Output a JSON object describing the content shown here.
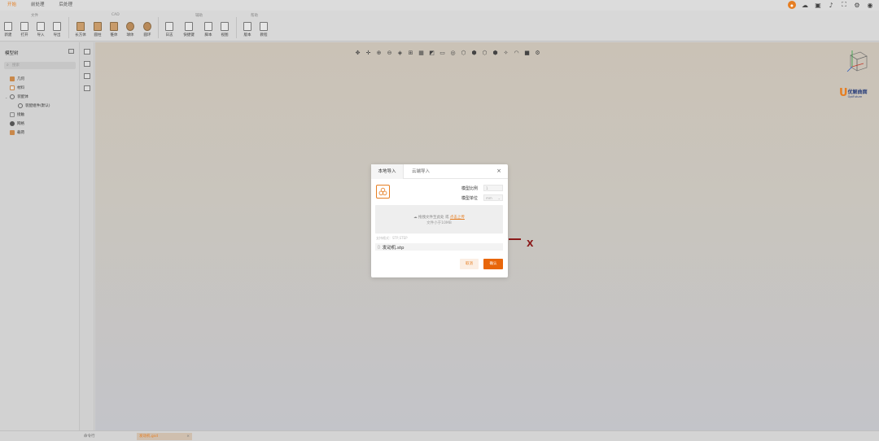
{
  "menubar": {
    "tabs": [
      "开始",
      "前处理",
      "后处理"
    ]
  },
  "ribbon": {
    "groups": [
      "文件",
      "CAD",
      "辅助",
      "帮助"
    ],
    "tools": [
      "新建",
      "打开",
      "导入",
      "导出",
      "长方体",
      "圆柱",
      "锥体",
      "球体",
      "圆环",
      "日志",
      "快捷键",
      "脚本",
      "视图",
      "版本",
      "教程"
    ]
  },
  "left_panel": {
    "title": "模型树",
    "search_placeholder": "搜索",
    "items": [
      "几何",
      "材料",
      "装配体",
      "装配组件(默认)",
      "接触",
      "网格",
      "载荷"
    ]
  },
  "viewport": {
    "axis_label": "X",
    "brand": {
      "cn": "优解曲面",
      "en": "OptFuture"
    }
  },
  "status": {
    "left_text": "命令行",
    "file_tab": "发动机.gsd",
    "file_tab_close": "×"
  },
  "dialog": {
    "tab_local": "本地导入",
    "tab_cloud": "云端导入",
    "close": "×",
    "scale_label": "模型比例",
    "scale_value": "1",
    "unit_label": "模型单位",
    "unit_value": "mm",
    "drop_text": "拖拽文件至此处 或",
    "drop_link": "点击上传",
    "size_hint": "文件小于10MB",
    "formats": "支持格式：STP,STEP",
    "file_name": "发动机.stp",
    "cancel": "取消",
    "confirm": "确认"
  },
  "colors": {
    "accent": "#e67e22",
    "axis_x": "#8b1a1a"
  }
}
